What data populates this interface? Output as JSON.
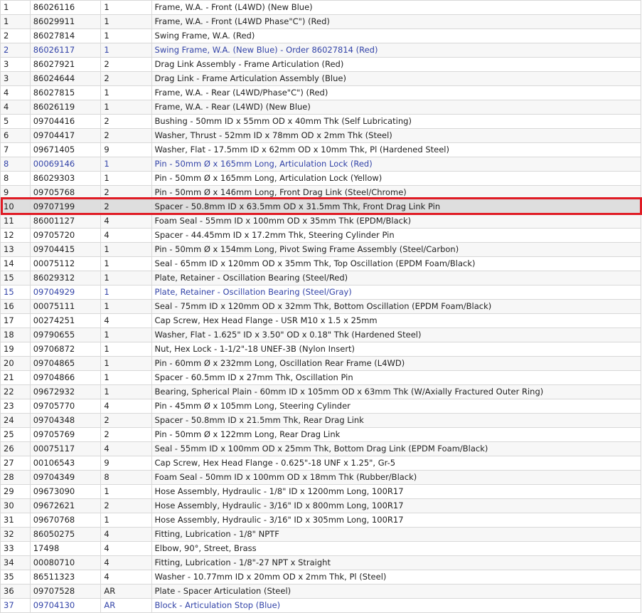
{
  "highlight_color": "#e01b24",
  "alt_text_color": "#3344a8",
  "selected_row_index": 14,
  "rows": [
    {
      "ref": "1",
      "part": "86026116",
      "qty": "1",
      "desc": "Frame, W.A. - Front (L4WD) (New Blue)",
      "alt": false
    },
    {
      "ref": "1",
      "part": "86029911",
      "qty": "1",
      "desc": "Frame, W.A. - Front (L4WD Phase\"C\") (Red)",
      "alt": false
    },
    {
      "ref": "2",
      "part": "86027814",
      "qty": "1",
      "desc": "Swing Frame, W.A. (Red)",
      "alt": false
    },
    {
      "ref": "2",
      "part": "86026117",
      "qty": "1",
      "desc": "Swing Frame, W.A. (New Blue) - Order 86027814 (Red)",
      "alt": true
    },
    {
      "ref": "3",
      "part": "86027921",
      "qty": "2",
      "desc": "Drag Link Assembly - Frame Articulation (Red)",
      "alt": false
    },
    {
      "ref": "3",
      "part": "86024644",
      "qty": "2",
      "desc": "Drag Link - Frame Articulation Assembly (Blue)",
      "alt": false
    },
    {
      "ref": "4",
      "part": "86027815",
      "qty": "1",
      "desc": "Frame, W.A. - Rear (L4WD/Phase\"C\") (Red)",
      "alt": false
    },
    {
      "ref": "4",
      "part": "86026119",
      "qty": "1",
      "desc": "Frame, W.A. - Rear (L4WD) (New Blue)",
      "alt": false
    },
    {
      "ref": "5",
      "part": "09704416",
      "qty": "2",
      "desc": "Bushing - 50mm ID x 55mm OD x 40mm Thk (Self Lubricating)",
      "alt": false
    },
    {
      "ref": "6",
      "part": "09704417",
      "qty": "2",
      "desc": "Washer, Thrust - 52mm ID x 78mm OD x 2mm Thk (Steel)",
      "alt": false
    },
    {
      "ref": "7",
      "part": "09671405",
      "qty": "9",
      "desc": "Washer, Flat - 17.5mm ID x 62mm OD x 10mm Thk, Pl (Hardened Steel)",
      "alt": false
    },
    {
      "ref": "8",
      "part": "00069146",
      "qty": "1",
      "desc": "Pin - 50mm Ø x 165mm Long, Articulation Lock (Red)",
      "alt": true
    },
    {
      "ref": "8",
      "part": "86029303",
      "qty": "1",
      "desc": "Pin - 50mm Ø x 165mm Long, Articulation Lock (Yellow)",
      "alt": false
    },
    {
      "ref": "9",
      "part": "09705768",
      "qty": "2",
      "desc": "Pin - 50mm Ø x 146mm Long, Front Drag Link (Steel/Chrome)",
      "alt": false
    },
    {
      "ref": "10",
      "part": "09707199",
      "qty": "2",
      "desc": "Spacer - 50.8mm ID x 63.5mm OD x 31.5mm Thk, Front Drag Link Pin",
      "alt": false
    },
    {
      "ref": "11",
      "part": "86001127",
      "qty": "4",
      "desc": "Foam Seal - 55mm ID x 100mm OD x 35mm Thk (EPDM/Black)",
      "alt": false
    },
    {
      "ref": "12",
      "part": "09705720",
      "qty": "4",
      "desc": "Spacer - 44.45mm ID x 17.2mm Thk, Steering Cylinder Pin",
      "alt": false
    },
    {
      "ref": "13",
      "part": "09704415",
      "qty": "1",
      "desc": "Pin - 50mm Ø x 154mm Long, Pivot Swing Frame Assembly (Steel/Carbon)",
      "alt": false
    },
    {
      "ref": "14",
      "part": "00075112",
      "qty": "1",
      "desc": "Seal - 65mm ID x 120mm OD x 35mm Thk, Top Oscillation (EPDM Foam/Black)",
      "alt": false
    },
    {
      "ref": "15",
      "part": "86029312",
      "qty": "1",
      "desc": "Plate, Retainer - Oscillation Bearing (Steel/Red)",
      "alt": false
    },
    {
      "ref": "15",
      "part": "09704929",
      "qty": "1",
      "desc": "Plate, Retainer - Oscillation Bearing (Steel/Gray)",
      "alt": true
    },
    {
      "ref": "16",
      "part": "00075111",
      "qty": "1",
      "desc": "Seal - 75mm ID x 120mm OD x 32mm Thk, Bottom Oscillation (EPDM Foam/Black)",
      "alt": false
    },
    {
      "ref": "17",
      "part": "00274251",
      "qty": "4",
      "desc": "Cap Screw, Hex Head Flange - USR M10 x 1.5 x 25mm",
      "alt": false
    },
    {
      "ref": "18",
      "part": "09790655",
      "qty": "1",
      "desc": "Washer, Flat - 1.625\" ID x 3.50\" OD x 0.18\" Thk (Hardened Steel)",
      "alt": false
    },
    {
      "ref": "19",
      "part": "09706872",
      "qty": "1",
      "desc": "Nut, Hex Lock - 1-1/2\"-18 UNEF-3B (Nylon Insert)",
      "alt": false
    },
    {
      "ref": "20",
      "part": "09704865",
      "qty": "1",
      "desc": "Pin - 60mm Ø x 232mm Long, Oscillation Rear Frame (L4WD)",
      "alt": false
    },
    {
      "ref": "21",
      "part": "09704866",
      "qty": "1",
      "desc": "Spacer - 60.5mm ID x 27mm Thk, Oscillation Pin",
      "alt": false
    },
    {
      "ref": "22",
      "part": "09672932",
      "qty": "1",
      "desc": "Bearing, Spherical Plain - 60mm ID x 105mm OD x 63mm Thk (W/Axially Fractured Outer Ring)",
      "alt": false
    },
    {
      "ref": "23",
      "part": "09705770",
      "qty": "4",
      "desc": "Pin - 45mm Ø x 105mm Long, Steering Cylinder",
      "alt": false
    },
    {
      "ref": "24",
      "part": "09704348",
      "qty": "2",
      "desc": "Spacer - 50.8mm ID x 21.5mm Thk, Rear Drag Link",
      "alt": false
    },
    {
      "ref": "25",
      "part": "09705769",
      "qty": "2",
      "desc": "Pin - 50mm Ø x 122mm Long, Rear Drag Link",
      "alt": false
    },
    {
      "ref": "26",
      "part": "00075117",
      "qty": "4",
      "desc": "Seal - 55mm ID x 100mm OD x 25mm Thk, Bottom Drag Link (EPDM Foam/Black)",
      "alt": false
    },
    {
      "ref": "27",
      "part": "00106543",
      "qty": "9",
      "desc": "Cap Screw, Hex Head Flange - 0.625\"-18 UNF x 1.25\", Gr-5",
      "alt": false
    },
    {
      "ref": "28",
      "part": "09704349",
      "qty": "8",
      "desc": "Foam Seal - 50mm ID x 100mm OD x 18mm Thk (Rubber/Black)",
      "alt": false
    },
    {
      "ref": "29",
      "part": "09673090",
      "qty": "1",
      "desc": "Hose Assembly, Hydraulic - 1/8\" ID x 1200mm Long, 100R17",
      "alt": false
    },
    {
      "ref": "30",
      "part": "09672621",
      "qty": "2",
      "desc": "Hose Assembly, Hydraulic - 3/16\" ID x 800mm Long, 100R17",
      "alt": false
    },
    {
      "ref": "31",
      "part": "09670768",
      "qty": "1",
      "desc": "Hose Assembly, Hydraulic - 3/16\" ID x 305mm Long, 100R17",
      "alt": false
    },
    {
      "ref": "32",
      "part": "86050275",
      "qty": "4",
      "desc": "Fitting, Lubrication - 1/8\" NPTF",
      "alt": false
    },
    {
      "ref": "33",
      "part": "17498",
      "qty": "4",
      "desc": "Elbow, 90°, Street, Brass",
      "alt": false
    },
    {
      "ref": "34",
      "part": "00080710",
      "qty": "4",
      "desc": "Fitting, Lubrication - 1/8\"-27 NPT x Straight",
      "alt": false
    },
    {
      "ref": "35",
      "part": "86511323",
      "qty": "4",
      "desc": "Washer - 10.77mm ID x 20mm OD x 2mm Thk, Pl (Steel)",
      "alt": false
    },
    {
      "ref": "36",
      "part": "09707528",
      "qty": "AR",
      "desc": "Plate - Spacer Articulation (Steel)",
      "alt": false
    },
    {
      "ref": "37",
      "part": "09704130",
      "qty": "AR",
      "desc": "Block - Articulation Stop (Blue)",
      "alt": true
    }
  ]
}
